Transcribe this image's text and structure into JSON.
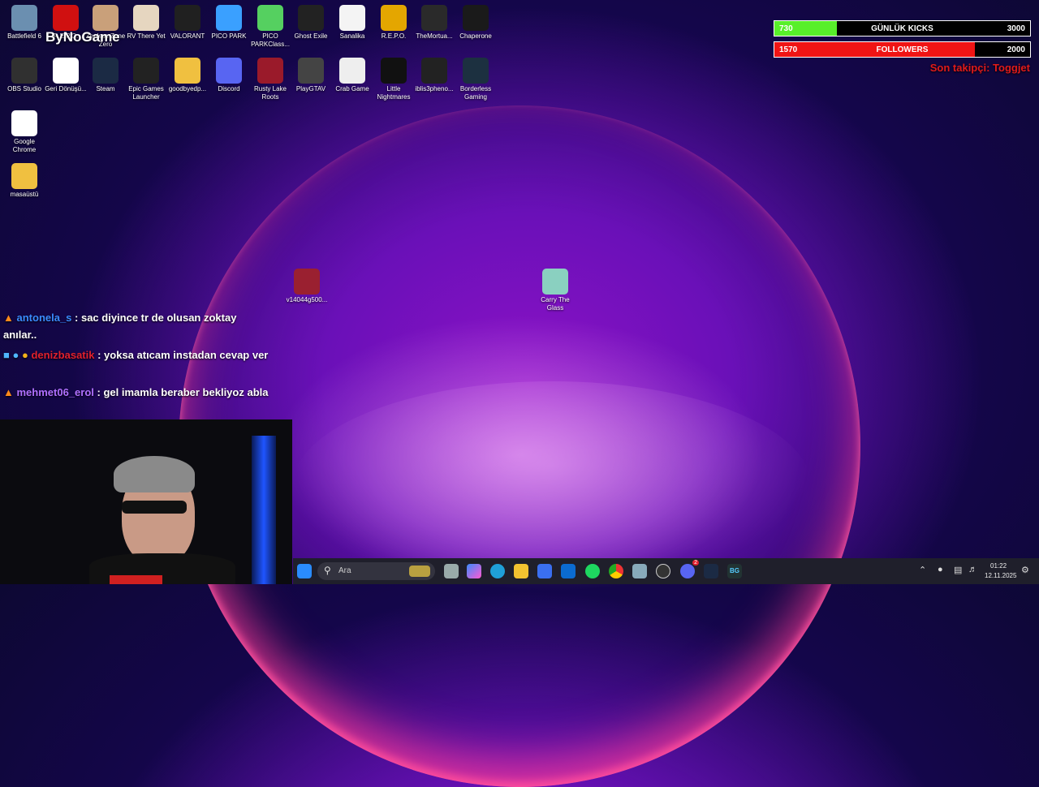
{
  "overlay": {
    "kicks_value": "730",
    "kicks_label": "GÜNLÜK KICKS",
    "kicks_goal": "3000",
    "kicks_progress": 0.243,
    "followers_value": "1570",
    "followers_label": "FOLLOWERS",
    "followers_goal": "2000",
    "followers_progress": 0.785,
    "last_follower": "Son takipçi: Toggjet",
    "streamer_logo": "ByNoGame"
  },
  "desktop_icons": [
    {
      "label": "Battlefield 6",
      "icon": "battlefield-icon"
    },
    {
      "label": "R.E.P.O.",
      "icon": "repo-icon"
    },
    {
      "label": "Zenless Zone Zero",
      "icon": "game-icon"
    },
    {
      "label": "RV There Yet",
      "icon": "rv-there-yet-icon"
    },
    {
      "label": "VALORANT",
      "icon": "valorant-icon"
    },
    {
      "label": "PICO PARK",
      "icon": "pico-park-icon"
    },
    {
      "label": "PICO PARKClass...",
      "icon": "pico-park-classic-icon"
    },
    {
      "label": "Ghost Exile",
      "icon": "ghost-exile-icon"
    },
    {
      "label": "Sanalika",
      "icon": "sanalika-icon"
    },
    {
      "label": "R.E.P.O.",
      "icon": "repo-game-icon"
    },
    {
      "label": "TheMortua...",
      "icon": "the-mortuary-icon"
    },
    {
      "label": "Chaperone",
      "icon": "chaperone-icon"
    },
    {
      "label": "OBS Studio",
      "icon": "obs-icon"
    },
    {
      "label": "Geri Dönüşü...",
      "icon": "recycle-bin-icon"
    },
    {
      "label": "Steam",
      "icon": "steam-icon"
    },
    {
      "label": "Epic Games Launcher",
      "icon": "epic-games-icon"
    },
    {
      "label": "goodbyedp...",
      "icon": "folder-icon"
    },
    {
      "label": "Discord",
      "icon": "discord-icon"
    },
    {
      "label": "Rusty Lake Roots",
      "icon": "rusty-lake-icon"
    },
    {
      "label": "PlayGTAV",
      "icon": "gtav-icon"
    },
    {
      "label": "Crab Game",
      "icon": "crab-game-icon"
    },
    {
      "label": "Little Nightmares",
      "icon": "little-nightmares-icon"
    },
    {
      "label": "iblis3pheno...",
      "icon": "iblis-icon"
    },
    {
      "label": "Borderless Gaming",
      "icon": "borderless-gaming-icon"
    },
    {
      "label": "Google Chrome",
      "icon": "chrome-icon"
    },
    {
      "label": "masaüstü",
      "icon": "folder-icon"
    },
    {
      "label": "v14044g500...",
      "icon": "file-icon"
    },
    {
      "label": "Carry The Glass",
      "icon": "carry-the-glass-icon"
    }
  ],
  "chat": [
    {
      "user": "antonela_s",
      "user_color": "#3a8bff",
      "message": " : sac diyince tr de olusan zoktay anılar.."
    },
    {
      "user": "denizbasatik",
      "user_color": "#e0202e",
      "message": " : yoksa atıcam instadan cevap ver"
    },
    {
      "user": "mehmet06_erol",
      "user_color": "#b070ff",
      "message": " : gel imamla beraber bekliyoz abla"
    }
  ],
  "taskbar": {
    "search_placeholder": "Ara",
    "time": "01:22",
    "date": "12.11.2025",
    "discord_badge": "2",
    "pinned": [
      "windows-start-icon",
      "task-view-icon",
      "copilot-icon",
      "edge-icon",
      "file-explorer-icon",
      "store-icon",
      "outlook-icon",
      "spotify-icon",
      "chrome-icon",
      "settings-icon",
      "obs-icon",
      "discord-icon",
      "steam-icon",
      "borderless-gaming-icon"
    ]
  }
}
